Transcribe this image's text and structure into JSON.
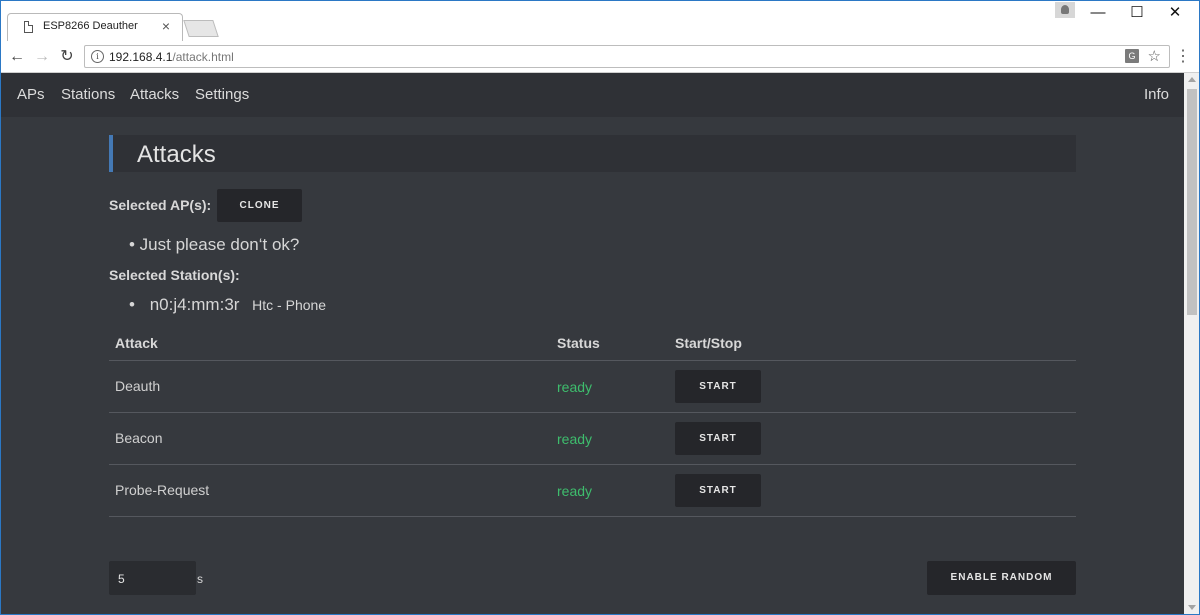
{
  "browser": {
    "tab_title": "ESP8266 Deauther",
    "tab_close": "×",
    "window_controls": {
      "minimize": "—",
      "maximize": "☐",
      "close": "✕"
    },
    "nav_icons": {
      "back": "←",
      "forward": "→",
      "reload": "↻"
    },
    "url_host": "192.168.4.1",
    "url_path": "/attack.html",
    "icons": [
      "page-icon",
      "user-icon",
      "info-icon",
      "translate-icon",
      "star-icon",
      "menu-icon"
    ]
  },
  "nav": {
    "items": [
      "APs",
      "Stations",
      "Attacks",
      "Settings"
    ],
    "info": "Info"
  },
  "page": {
    "title": "Attacks",
    "selected_aps_label": "Selected AP(s):",
    "clone_button": "CLONE",
    "selected_ap": "• Just please don‘t ok?",
    "selected_stations_label": "Selected Station(s):",
    "station_bullet": "•",
    "station_mac": "n0:j4:mm:3r",
    "station_vendor": "Htc - Phone"
  },
  "table": {
    "headers": [
      "Attack",
      "Status",
      "Start/Stop"
    ],
    "rows": [
      {
        "name": "Deauth",
        "status": "ready",
        "action": "START"
      },
      {
        "name": "Beacon",
        "status": "ready",
        "action": "START"
      },
      {
        "name": "Probe-Request",
        "status": "ready",
        "action": "START"
      }
    ]
  },
  "random": {
    "seconds_value": "5",
    "seconds_unit": "s",
    "button": "ENABLE RANDOM"
  },
  "colors": {
    "accent": "#4479b5",
    "status_ready": "#3ebd6d",
    "background": "#36393e",
    "navbar": "#2f3136"
  }
}
